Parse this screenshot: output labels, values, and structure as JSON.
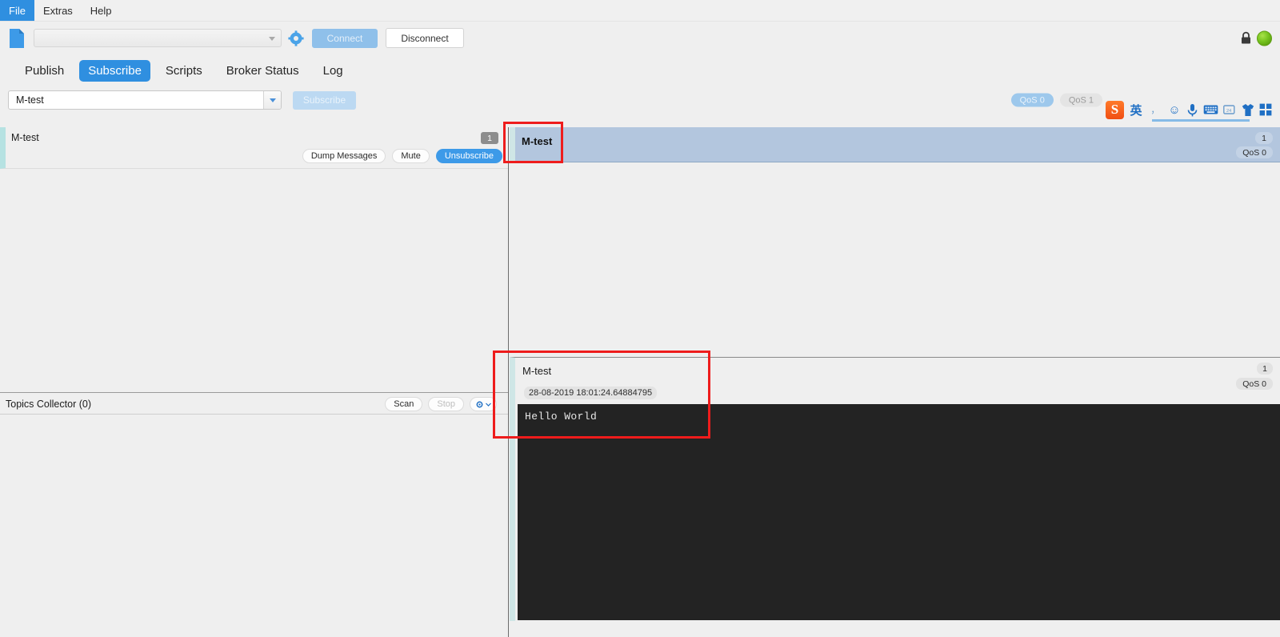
{
  "menubar": {
    "items": [
      {
        "label": "File",
        "active": true
      },
      {
        "label": "Extras",
        "active": false
      },
      {
        "label": "Help",
        "active": false
      }
    ]
  },
  "connection_bar": {
    "broker_value": "",
    "broker_placeholder": "",
    "connect_label": "Connect",
    "disconnect_label": "Disconnect",
    "settings_icon": "gear-icon",
    "profile_icon": "document-icon",
    "lock_icon": "lock-icon",
    "status_indicator": "green-circle",
    "status_color": "#77c41f"
  },
  "tabs": [
    {
      "label": "Publish",
      "active": false
    },
    {
      "label": "Subscribe",
      "active": true
    },
    {
      "label": "Scripts",
      "active": false
    },
    {
      "label": "Broker Status",
      "active": false
    },
    {
      "label": "Log",
      "active": false
    }
  ],
  "subscribe_row": {
    "topic_value": "M-test",
    "topic_placeholder": "",
    "subscribe_label": "Subscribe",
    "qos_options": [
      {
        "label": "QoS 0",
        "selected": true
      },
      {
        "label": "QoS 1",
        "selected": false
      }
    ]
  },
  "ime_toolbar": {
    "logo": "sogou-logo",
    "logo_text": "S",
    "icons": [
      {
        "name": "chinese-english-toggle-icon",
        "glyph": "英"
      },
      {
        "name": "punctuation-icon",
        "glyph": "，"
      },
      {
        "name": "emoji-icon",
        "glyph": "☺"
      },
      {
        "name": "voice-input-icon",
        "glyph": "⬤"
      },
      {
        "name": "soft-keyboard-icon",
        "glyph": "⌨"
      },
      {
        "name": "handwriting-icon",
        "glyph": "✎"
      },
      {
        "name": "skin-icon",
        "glyph": "♣"
      },
      {
        "name": "toolbox-icon",
        "glyph": "☷"
      }
    ]
  },
  "subscription_list": {
    "entry": {
      "topic": "M-test",
      "count": "1",
      "actions": [
        {
          "label": "Dump Messages",
          "primary": false
        },
        {
          "label": "Mute",
          "primary": false
        },
        {
          "label": "Unsubscribe",
          "primary": true
        }
      ]
    }
  },
  "topics_collector": {
    "title": "Topics Collector (0)",
    "scan_label": "Scan",
    "stop_label": "Stop",
    "options_icon": "settings-dropdown-icon"
  },
  "message_pane": {
    "header": {
      "topic": "M-test",
      "count": "1",
      "qos": "QoS 0"
    },
    "message": {
      "topic": "M-test",
      "count": "1",
      "qos": "QoS 0",
      "timestamp": "28-08-2019 18:01:24.64884795",
      "payload": "Hello World"
    }
  },
  "annotations": {
    "highlight_color": "#ee1c1c",
    "boxes": [
      {
        "name": "topic-header-highlight"
      },
      {
        "name": "message-card-highlight"
      }
    ]
  }
}
